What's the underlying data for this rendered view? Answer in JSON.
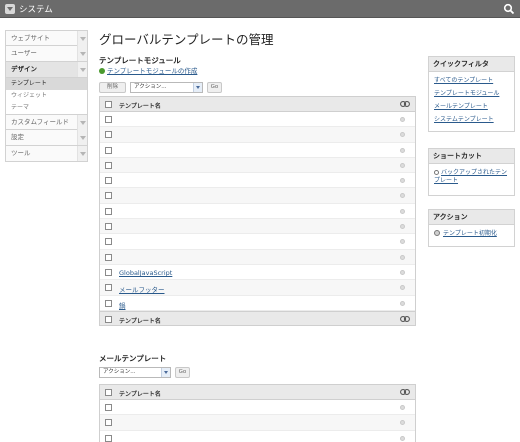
{
  "header": {
    "title": "システム"
  },
  "sidebar": {
    "items": [
      {
        "label": "ウェブサイト"
      },
      {
        "label": "ユーザー"
      },
      {
        "label": "デザイン"
      },
      {
        "label": "カスタムフィールド"
      },
      {
        "label": "設定"
      },
      {
        "label": "ツール"
      }
    ],
    "design_subitems": [
      {
        "label": "テンプレート"
      },
      {
        "label": "ウィジェット"
      },
      {
        "label": "テーマ"
      }
    ]
  },
  "main": {
    "title": "グローバルテンプレートの管理",
    "modules": {
      "title": "テンプレートモジュール",
      "create_link": "テンプレートモジュールの作成",
      "delete_button": "削除",
      "action_select": "アクション...",
      "go_button": "Go",
      "column_header": "テンプレート名",
      "rows": [
        {
          "name": ""
        },
        {
          "name": ""
        },
        {
          "name": ""
        },
        {
          "name": ""
        },
        {
          "name": ""
        },
        {
          "name": ""
        },
        {
          "name": ""
        },
        {
          "name": ""
        },
        {
          "name": ""
        },
        {
          "name": ""
        },
        {
          "name": "GlobalJavaScript"
        },
        {
          "name": "メールフッター"
        },
        {
          "name": "鍋"
        }
      ]
    },
    "mail": {
      "title": "メールテンプレート",
      "action_select": "アクション...",
      "go_button": "Go",
      "column_header": "テンプレート名",
      "rows": [
        {
          "name": ""
        },
        {
          "name": ""
        },
        {
          "name": ""
        }
      ]
    }
  },
  "widgets": {
    "quick_filter": {
      "title": "クイックフィルタ",
      "links": [
        "すべてのテンプレート",
        "テンプレートモジュール",
        "メールテンプレート",
        "システムテンプレート"
      ]
    },
    "shortcut": {
      "title": "ショートカット",
      "link": "バックアップされたテンプレート"
    },
    "action": {
      "title": "アクション",
      "link": "テンプレート初期化"
    }
  },
  "colors": {
    "topbar": "#6b6b6b",
    "link": "#2a5a8c",
    "add_icon": "#4a9a2e"
  }
}
